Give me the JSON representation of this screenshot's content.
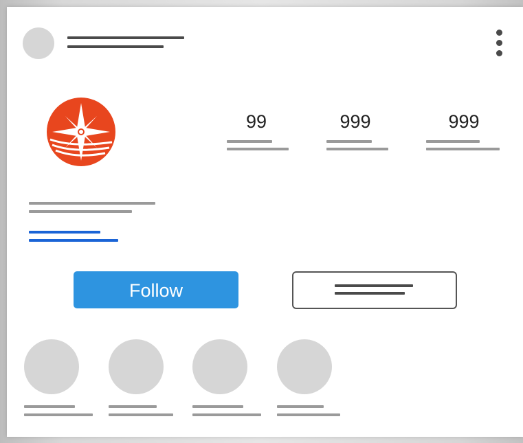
{
  "stats": [
    {
      "value": "99"
    },
    {
      "value": "999"
    },
    {
      "value": "999"
    }
  ],
  "actions": {
    "follow_label": "Follow"
  },
  "colors": {
    "accent": "#2e94e0",
    "link": "#1b64d6",
    "logo": "#e8461e"
  },
  "icons": {
    "menu": "more-vertical-icon",
    "logo": "compass-star-logo"
  }
}
